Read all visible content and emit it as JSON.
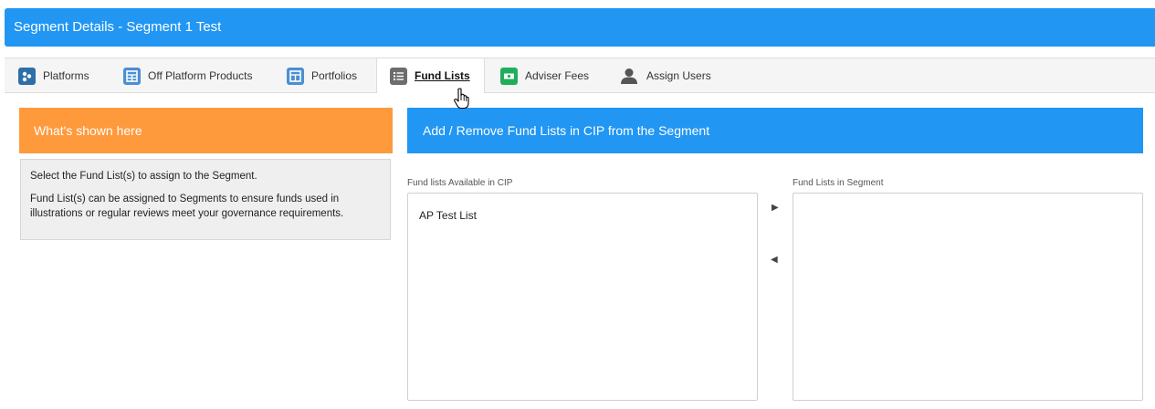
{
  "header": {
    "title": "Segment Details - Segment 1 Test"
  },
  "tabs": [
    {
      "label": "Platforms",
      "icon": "platforms-icon",
      "color": "#2f6fa8"
    },
    {
      "label": "Off Platform Products",
      "icon": "table-icon",
      "color": "#4a8fd4"
    },
    {
      "label": "Portfolios",
      "icon": "portfolio-icon",
      "color": "#4a8fd4"
    },
    {
      "label": "Fund Lists",
      "icon": "list-icon",
      "color": "#6d6d6d",
      "active": true
    },
    {
      "label": "Adviser Fees",
      "icon": "money-icon",
      "color": "#1fae5c"
    },
    {
      "label": "Assign Users",
      "icon": "user-icon",
      "color": "#555555"
    }
  ],
  "left_panel": {
    "title": "What's shown here",
    "text1": "Select the Fund List(s) to assign to the Segment.",
    "text2": "Fund List(s) can be assigned to Segments to ensure funds used in illustrations or regular reviews meet your governance requirements."
  },
  "right_panel": {
    "title": "Add / Remove Fund Lists in CIP from the Segment",
    "available_label": "Fund lists Available in CIP",
    "available_items": [
      "AP Test List"
    ],
    "segment_label": "Fund Lists in Segment",
    "segment_items": []
  },
  "colors": {
    "header": "#2196f3",
    "orange": "#ff9a3c"
  }
}
